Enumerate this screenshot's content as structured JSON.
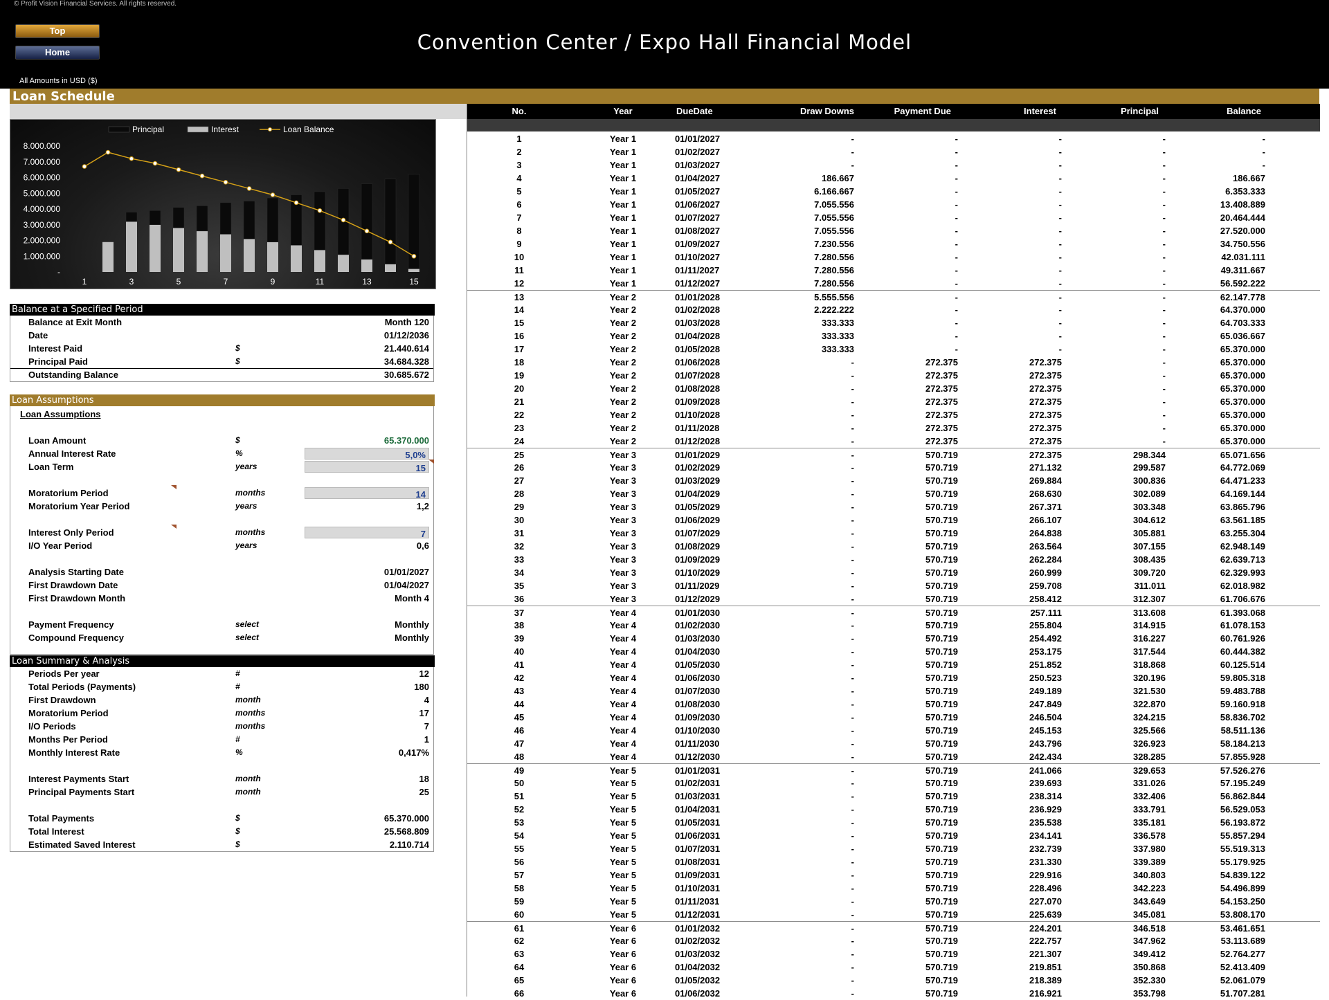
{
  "copyright": "© Profit Vision Financial Services. All rights reserved.",
  "nav": {
    "top_label": "Top",
    "home_label": "Home"
  },
  "app_title": "Convention Center / Expo Hall Financial Model",
  "amounts_note": "All Amounts in  USD ($)",
  "section_title": "Loan Schedule",
  "chart_data": {
    "type": "bar",
    "legend": [
      "Principal",
      "Interest",
      "Loan Balance"
    ],
    "legend_placement": "top",
    "categories": [
      1,
      2,
      3,
      4,
      5,
      6,
      7,
      8,
      9,
      10,
      11,
      12,
      13,
      14,
      15
    ],
    "x_tick_labels": [
      "1",
      "3",
      "5",
      "7",
      "9",
      "11",
      "13",
      "15"
    ],
    "y_tick_labels": [
      "8.000.000",
      "7.000.000",
      "6.000.000",
      "5.000.000",
      "4.000.000",
      "3.000.000",
      "2.000.000",
      "1.000.000",
      "-"
    ],
    "ylim": [
      0,
      8000000
    ],
    "stacked": true,
    "series": [
      {
        "name": "Interest",
        "type": "bar",
        "color": "#bfbfbf",
        "values": [
          0,
          1900000,
          3200000,
          3000000,
          2800000,
          2600000,
          2400000,
          2100000,
          1900000,
          1700000,
          1400000,
          1100000,
          800000,
          500000,
          200000
        ]
      },
      {
        "name": "Principal",
        "type": "bar",
        "color": "#0a0a0a",
        "values": [
          0,
          0,
          600000,
          900000,
          1300000,
          1600000,
          2000000,
          2400000,
          2800000,
          3200000,
          3700000,
          4200000,
          4800000,
          5400000,
          6000000
        ]
      },
      {
        "name": "Loan Balance",
        "type": "line",
        "color": "#d4a017",
        "values": [
          6700000,
          7600000,
          7200000,
          6900000,
          6500000,
          6100000,
          5700000,
          5300000,
          4900000,
          4400000,
          3900000,
          3300000,
          2600000,
          1900000,
          1000000
        ]
      }
    ]
  },
  "balance_period": {
    "header": "Balance at a Specified Period",
    "rows": [
      {
        "label": "Balance at Exit Month",
        "unit": "",
        "value": "Month 120"
      },
      {
        "label": "Date",
        "unit": "",
        "value": "01/12/2036"
      },
      {
        "label": "Interest Paid",
        "unit": "$",
        "value": "21.440.614"
      },
      {
        "label": "Principal Paid",
        "unit": "$",
        "value": "34.684.328"
      },
      {
        "label": "Outstanding Balance",
        "unit": "",
        "value": "30.685.672"
      }
    ]
  },
  "assumptions": {
    "header": "Loan Assumptions",
    "subheader": "Loan Assumptions",
    "loan_amount": {
      "label": "Loan Amount",
      "unit": "$",
      "value": "65.370.000"
    },
    "interest_rate": {
      "label": "Annual Interest Rate",
      "unit": "%",
      "value": "5,0%"
    },
    "loan_term": {
      "label": "Loan Term",
      "unit": "years",
      "value": "15"
    },
    "moratorium_period": {
      "label": "Moratorium Period",
      "unit": "months",
      "value": "14"
    },
    "moratorium_year": {
      "label": "Moratorium Year Period",
      "unit": "years",
      "value": "1,2"
    },
    "io_period": {
      "label": "Interest Only Period",
      "unit": "months",
      "value": "7"
    },
    "io_year": {
      "label": "I/O Year Period",
      "unit": "years",
      "value": "0,6"
    },
    "start_date": {
      "label": "Analysis Starting Date",
      "unit": "",
      "value": "01/01/2027"
    },
    "first_draw_date": {
      "label": "First Drawdown Date",
      "unit": "",
      "value": "01/04/2027"
    },
    "first_draw_month": {
      "label": "First Drawdown Month",
      "unit": "",
      "value": "Month 4"
    },
    "payment_freq": {
      "label": "Payment Frequency",
      "unit": "select",
      "value": "Monthly"
    },
    "compound_freq": {
      "label": "Compound Frequency",
      "unit": "select",
      "value": "Monthly"
    }
  },
  "summary": {
    "header": "Loan Summary & Analysis",
    "rows": [
      {
        "label": "Periods Per year",
        "unit": "#",
        "value": "12"
      },
      {
        "label": "Total Periods (Payments)",
        "unit": "#",
        "value": "180"
      },
      {
        "label": "First Drawdown",
        "unit": "month",
        "value": "4"
      },
      {
        "label": "Moratorium Period",
        "unit": "months",
        "value": "17"
      },
      {
        "label": "I/O Periods",
        "unit": "months",
        "value": "7"
      },
      {
        "label": "Months Per Period",
        "unit": "#",
        "value": "1"
      },
      {
        "label": "Monthly Interest Rate",
        "unit": "%",
        "value": "0,417%"
      },
      {
        "label": "Interest Payments Start",
        "unit": "month",
        "value": "18"
      },
      {
        "label": "Principal Payments Start",
        "unit": "month",
        "value": "25"
      },
      {
        "label": "Total Payments",
        "unit": "$",
        "value": "65.370.000"
      },
      {
        "label": "Total Interest",
        "unit": "$",
        "value": "25.568.809"
      },
      {
        "label": "Estimated Saved Interest",
        "unit": "$",
        "value": "2.110.714"
      }
    ]
  },
  "schedule": {
    "columns": [
      "No.",
      "Year",
      "DueDate",
      "Draw Downs",
      "Payment Due",
      "Interest",
      "Principal",
      "Balance"
    ],
    "rows": [
      [
        "1",
        "Year 1",
        "01/01/2027",
        "-",
        "-",
        "-",
        "-",
        "-"
      ],
      [
        "2",
        "Year 1",
        "01/02/2027",
        "-",
        "-",
        "-",
        "-",
        "-"
      ],
      [
        "3",
        "Year 1",
        "01/03/2027",
        "-",
        "-",
        "-",
        "-",
        "-"
      ],
      [
        "4",
        "Year 1",
        "01/04/2027",
        "186.667",
        "-",
        "-",
        "-",
        "186.667"
      ],
      [
        "5",
        "Year 1",
        "01/05/2027",
        "6.166.667",
        "-",
        "-",
        "-",
        "6.353.333"
      ],
      [
        "6",
        "Year 1",
        "01/06/2027",
        "7.055.556",
        "-",
        "-",
        "-",
        "13.408.889"
      ],
      [
        "7",
        "Year 1",
        "01/07/2027",
        "7.055.556",
        "-",
        "-",
        "-",
        "20.464.444"
      ],
      [
        "8",
        "Year 1",
        "01/08/2027",
        "7.055.556",
        "-",
        "-",
        "-",
        "27.520.000"
      ],
      [
        "9",
        "Year 1",
        "01/09/2027",
        "7.230.556",
        "-",
        "-",
        "-",
        "34.750.556"
      ],
      [
        "10",
        "Year 1",
        "01/10/2027",
        "7.280.556",
        "-",
        "-",
        "-",
        "42.031.111"
      ],
      [
        "11",
        "Year 1",
        "01/11/2027",
        "7.280.556",
        "-",
        "-",
        "-",
        "49.311.667"
      ],
      [
        "12",
        "Year 1",
        "01/12/2027",
        "7.280.556",
        "-",
        "-",
        "-",
        "56.592.222"
      ],
      [
        "13",
        "Year 2",
        "01/01/2028",
        "5.555.556",
        "-",
        "-",
        "-",
        "62.147.778"
      ],
      [
        "14",
        "Year 2",
        "01/02/2028",
        "2.222.222",
        "-",
        "-",
        "-",
        "64.370.000"
      ],
      [
        "15",
        "Year 2",
        "01/03/2028",
        "333.333",
        "-",
        "-",
        "-",
        "64.703.333"
      ],
      [
        "16",
        "Year 2",
        "01/04/2028",
        "333.333",
        "-",
        "-",
        "-",
        "65.036.667"
      ],
      [
        "17",
        "Year 2",
        "01/05/2028",
        "333.333",
        "-",
        "-",
        "-",
        "65.370.000"
      ],
      [
        "18",
        "Year 2",
        "01/06/2028",
        "-",
        "272.375",
        "272.375",
        "-",
        "65.370.000"
      ],
      [
        "19",
        "Year 2",
        "01/07/2028",
        "-",
        "272.375",
        "272.375",
        "-",
        "65.370.000"
      ],
      [
        "20",
        "Year 2",
        "01/08/2028",
        "-",
        "272.375",
        "272.375",
        "-",
        "65.370.000"
      ],
      [
        "21",
        "Year 2",
        "01/09/2028",
        "-",
        "272.375",
        "272.375",
        "-",
        "65.370.000"
      ],
      [
        "22",
        "Year 2",
        "01/10/2028",
        "-",
        "272.375",
        "272.375",
        "-",
        "65.370.000"
      ],
      [
        "23",
        "Year 2",
        "01/11/2028",
        "-",
        "272.375",
        "272.375",
        "-",
        "65.370.000"
      ],
      [
        "24",
        "Year 2",
        "01/12/2028",
        "-",
        "272.375",
        "272.375",
        "-",
        "65.370.000"
      ],
      [
        "25",
        "Year 3",
        "01/01/2029",
        "-",
        "570.719",
        "272.375",
        "298.344",
        "65.071.656"
      ],
      [
        "26",
        "Year 3",
        "01/02/2029",
        "-",
        "570.719",
        "271.132",
        "299.587",
        "64.772.069"
      ],
      [
        "27",
        "Year 3",
        "01/03/2029",
        "-",
        "570.719",
        "269.884",
        "300.836",
        "64.471.233"
      ],
      [
        "28",
        "Year 3",
        "01/04/2029",
        "-",
        "570.719",
        "268.630",
        "302.089",
        "64.169.144"
      ],
      [
        "29",
        "Year 3",
        "01/05/2029",
        "-",
        "570.719",
        "267.371",
        "303.348",
        "63.865.796"
      ],
      [
        "30",
        "Year 3",
        "01/06/2029",
        "-",
        "570.719",
        "266.107",
        "304.612",
        "63.561.185"
      ],
      [
        "31",
        "Year 3",
        "01/07/2029",
        "-",
        "570.719",
        "264.838",
        "305.881",
        "63.255.304"
      ],
      [
        "32",
        "Year 3",
        "01/08/2029",
        "-",
        "570.719",
        "263.564",
        "307.155",
        "62.948.149"
      ],
      [
        "33",
        "Year 3",
        "01/09/2029",
        "-",
        "570.719",
        "262.284",
        "308.435",
        "62.639.713"
      ],
      [
        "34",
        "Year 3",
        "01/10/2029",
        "-",
        "570.719",
        "260.999",
        "309.720",
        "62.329.993"
      ],
      [
        "35",
        "Year 3",
        "01/11/2029",
        "-",
        "570.719",
        "259.708",
        "311.011",
        "62.018.982"
      ],
      [
        "36",
        "Year 3",
        "01/12/2029",
        "-",
        "570.719",
        "258.412",
        "312.307",
        "61.706.676"
      ],
      [
        "37",
        "Year 4",
        "01/01/2030",
        "-",
        "570.719",
        "257.111",
        "313.608",
        "61.393.068"
      ],
      [
        "38",
        "Year 4",
        "01/02/2030",
        "-",
        "570.719",
        "255.804",
        "314.915",
        "61.078.153"
      ],
      [
        "39",
        "Year 4",
        "01/03/2030",
        "-",
        "570.719",
        "254.492",
        "316.227",
        "60.761.926"
      ],
      [
        "40",
        "Year 4",
        "01/04/2030",
        "-",
        "570.719",
        "253.175",
        "317.544",
        "60.444.382"
      ],
      [
        "41",
        "Year 4",
        "01/05/2030",
        "-",
        "570.719",
        "251.852",
        "318.868",
        "60.125.514"
      ],
      [
        "42",
        "Year 4",
        "01/06/2030",
        "-",
        "570.719",
        "250.523",
        "320.196",
        "59.805.318"
      ],
      [
        "43",
        "Year 4",
        "01/07/2030",
        "-",
        "570.719",
        "249.189",
        "321.530",
        "59.483.788"
      ],
      [
        "44",
        "Year 4",
        "01/08/2030",
        "-",
        "570.719",
        "247.849",
        "322.870",
        "59.160.918"
      ],
      [
        "45",
        "Year 4",
        "01/09/2030",
        "-",
        "570.719",
        "246.504",
        "324.215",
        "58.836.702"
      ],
      [
        "46",
        "Year 4",
        "01/10/2030",
        "-",
        "570.719",
        "245.153",
        "325.566",
        "58.511.136"
      ],
      [
        "47",
        "Year 4",
        "01/11/2030",
        "-",
        "570.719",
        "243.796",
        "326.923",
        "58.184.213"
      ],
      [
        "48",
        "Year 4",
        "01/12/2030",
        "-",
        "570.719",
        "242.434",
        "328.285",
        "57.855.928"
      ],
      [
        "49",
        "Year 5",
        "01/01/2031",
        "-",
        "570.719",
        "241.066",
        "329.653",
        "57.526.276"
      ],
      [
        "50",
        "Year 5",
        "01/02/2031",
        "-",
        "570.719",
        "239.693",
        "331.026",
        "57.195.249"
      ],
      [
        "51",
        "Year 5",
        "01/03/2031",
        "-",
        "570.719",
        "238.314",
        "332.406",
        "56.862.844"
      ],
      [
        "52",
        "Year 5",
        "01/04/2031",
        "-",
        "570.719",
        "236.929",
        "333.791",
        "56.529.053"
      ],
      [
        "53",
        "Year 5",
        "01/05/2031",
        "-",
        "570.719",
        "235.538",
        "335.181",
        "56.193.872"
      ],
      [
        "54",
        "Year 5",
        "01/06/2031",
        "-",
        "570.719",
        "234.141",
        "336.578",
        "55.857.294"
      ],
      [
        "55",
        "Year 5",
        "01/07/2031",
        "-",
        "570.719",
        "232.739",
        "337.980",
        "55.519.313"
      ],
      [
        "56",
        "Year 5",
        "01/08/2031",
        "-",
        "570.719",
        "231.330",
        "339.389",
        "55.179.925"
      ],
      [
        "57",
        "Year 5",
        "01/09/2031",
        "-",
        "570.719",
        "229.916",
        "340.803",
        "54.839.122"
      ],
      [
        "58",
        "Year 5",
        "01/10/2031",
        "-",
        "570.719",
        "228.496",
        "342.223",
        "54.496.899"
      ],
      [
        "59",
        "Year 5",
        "01/11/2031",
        "-",
        "570.719",
        "227.070",
        "343.649",
        "54.153.250"
      ],
      [
        "60",
        "Year 5",
        "01/12/2031",
        "-",
        "570.719",
        "225.639",
        "345.081",
        "53.808.170"
      ],
      [
        "61",
        "Year 6",
        "01/01/2032",
        "-",
        "570.719",
        "224.201",
        "346.518",
        "53.461.651"
      ],
      [
        "62",
        "Year 6",
        "01/02/2032",
        "-",
        "570.719",
        "222.757",
        "347.962",
        "53.113.689"
      ],
      [
        "63",
        "Year 6",
        "01/03/2032",
        "-",
        "570.719",
        "221.307",
        "349.412",
        "52.764.277"
      ],
      [
        "64",
        "Year 6",
        "01/04/2032",
        "-",
        "570.719",
        "219.851",
        "350.868",
        "52.413.409"
      ],
      [
        "65",
        "Year 6",
        "01/05/2032",
        "-",
        "570.719",
        "218.389",
        "352.330",
        "52.061.079"
      ],
      [
        "66",
        "Year 6",
        "01/06/2032",
        "-",
        "570.719",
        "216.921",
        "353.798",
        "51.707.281"
      ]
    ]
  }
}
